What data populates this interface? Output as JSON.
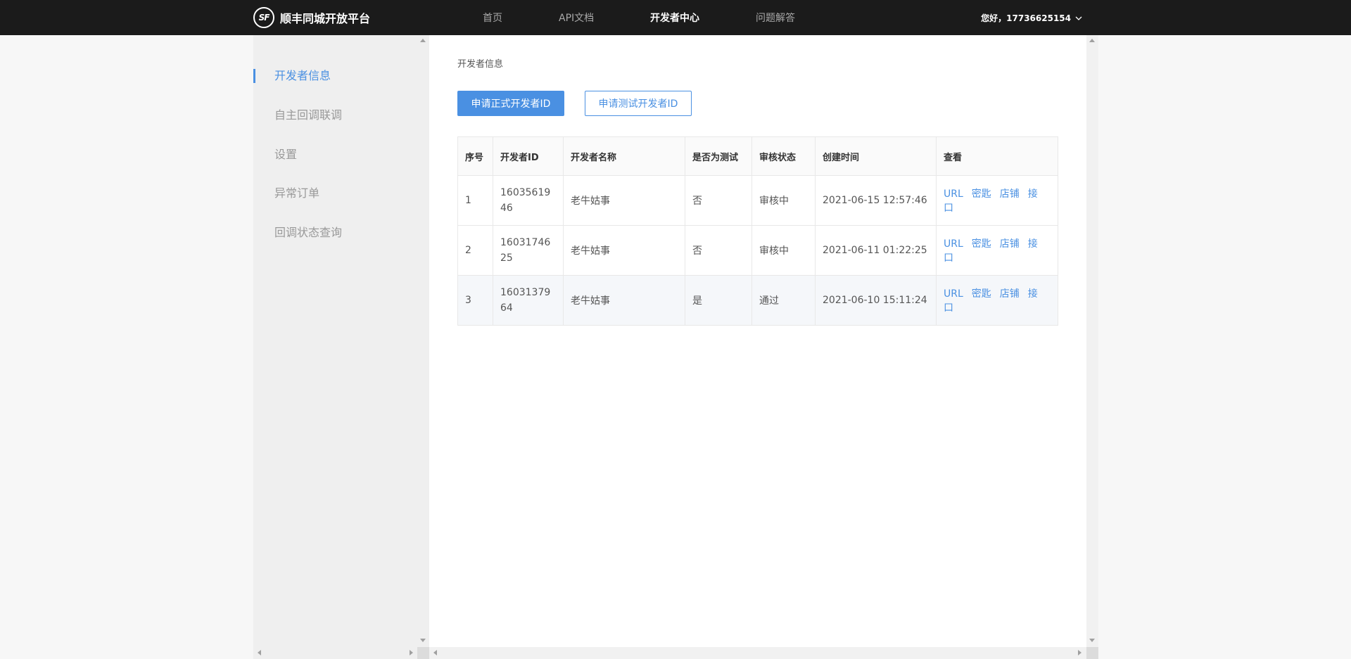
{
  "brand": {
    "logo_text": "SF",
    "name": "顺丰同城开放平台"
  },
  "nav": [
    {
      "label": "首页"
    },
    {
      "label": "API文档"
    },
    {
      "label": "开发者中心"
    },
    {
      "label": "问题解答"
    }
  ],
  "user": {
    "greeting": "您好，17736625154"
  },
  "sidebar": {
    "items": [
      {
        "label": "开发者信息"
      },
      {
        "label": "自主回调联调"
      },
      {
        "label": "设置"
      },
      {
        "label": "异常订单"
      },
      {
        "label": "回调状态查询"
      }
    ]
  },
  "main": {
    "breadcrumb": "开发者信息",
    "apply_formal": "申请正式开发者ID",
    "apply_test": "申请测试开发者ID",
    "table": {
      "headers": [
        "序号",
        "开发者ID",
        "开发者名称",
        "是否为测试",
        "审核状态",
        "创建时间",
        "查看"
      ],
      "rows": [
        {
          "no": "1",
          "id": "1603561946",
          "name": "老牛姑事",
          "test": "否",
          "status": "审核中",
          "time": "2021-06-15 12:57:46"
        },
        {
          "no": "2",
          "id": "1603174625",
          "name": "老牛姑事",
          "test": "否",
          "status": "审核中",
          "time": "2021-06-11 01:22:25"
        },
        {
          "no": "3",
          "id": "1603137964",
          "name": "老牛姑事",
          "test": "是",
          "status": "通过",
          "time": "2021-06-10 15:11:24"
        }
      ],
      "links": [
        "URL",
        "密匙",
        "店铺",
        "接口"
      ]
    }
  }
}
